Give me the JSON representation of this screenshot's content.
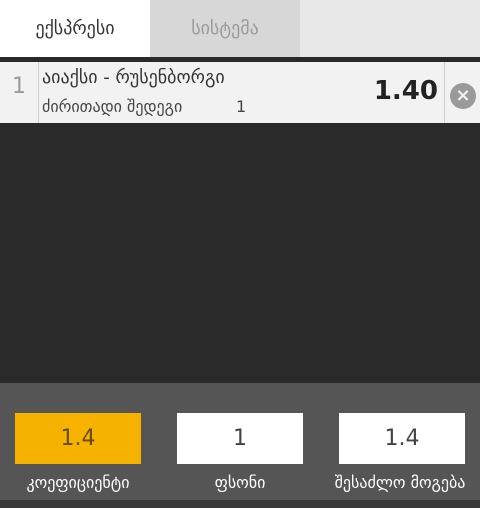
{
  "tabs": [
    {
      "label": "ექსპრესი",
      "active": true
    },
    {
      "label": "სისტემა",
      "active": false
    }
  ],
  "bet": {
    "number": "1",
    "match": "აიაქსი - რუსენბორგი",
    "market": "ძირითადი შედეგი",
    "selection": "1",
    "odds": "1.40",
    "remove_icon": "close-circle-icon"
  },
  "summary": {
    "coefficient_value": "1.4",
    "coefficient_label": "კოეფიციენტი",
    "stake_value": "1",
    "stake_label": "ფსონი",
    "possible_win_value": "1.4",
    "possible_win_label": "შესაძლო მოგება"
  },
  "colors": {
    "accent": "#f5b300",
    "dark_bg": "#2a2a2a",
    "panel_bg": "#555555"
  }
}
